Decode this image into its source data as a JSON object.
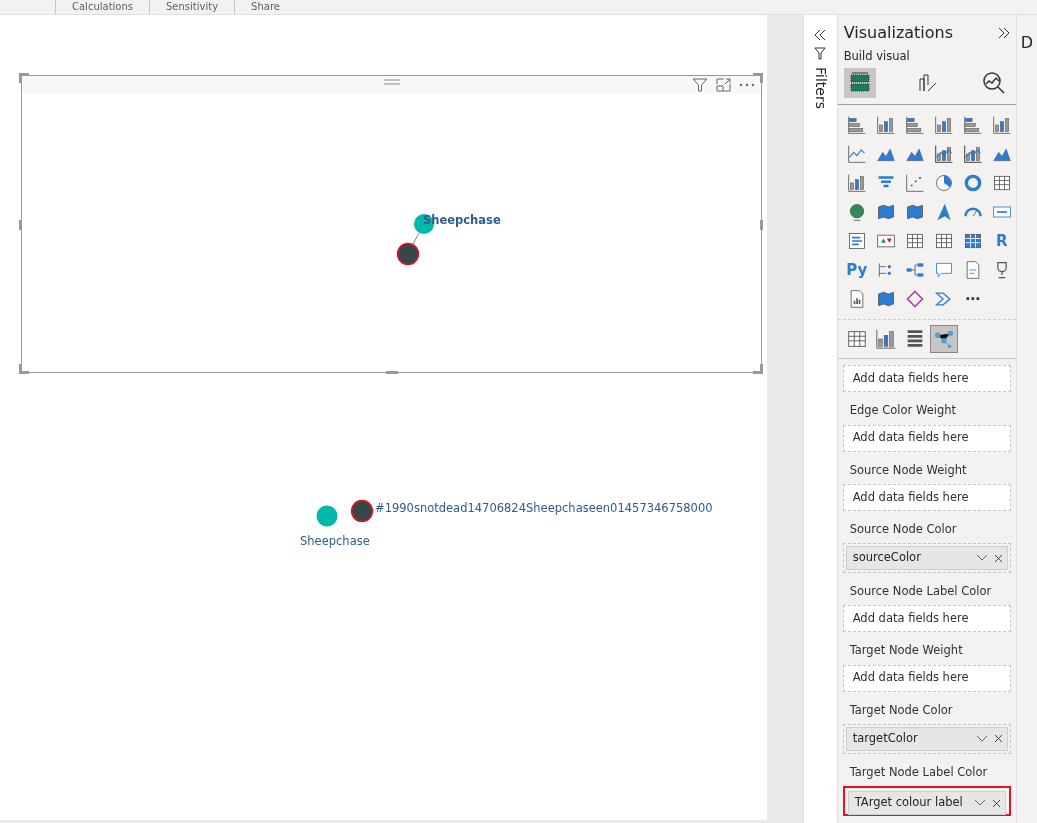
{
  "ribbon": {
    "tabs": [
      "Calculations",
      "Sensitivity",
      "Share"
    ]
  },
  "visual": {
    "nodes": [
      {
        "label": "Sheepchase",
        "color": "#01b8aa"
      },
      {
        "color": "#374649"
      }
    ]
  },
  "loose_graph": {
    "labels": [
      "Sheepchase",
      "#1990snotdead14706824Sheepchaseen01457346758000"
    ],
    "nodes": [
      {
        "color": "#01b8aa"
      },
      {
        "color": "#374649"
      }
    ]
  },
  "filters_pane": {
    "title": "Filters"
  },
  "visualizations": {
    "title": "Visualizations",
    "subtitle": "Build visual",
    "build_tabs": [
      {
        "selected": true
      },
      {
        "selected": false
      },
      {
        "selected": false
      }
    ],
    "gallery_texts": [
      "R",
      "Py",
      "⋯"
    ],
    "custom_visuals": [
      {
        "selected": false
      },
      {
        "selected": false
      },
      {
        "selected": false
      },
      {
        "selected": true
      }
    ],
    "wells": [
      {
        "placeholder": "Add data fields here",
        "highlighted": false
      },
      {
        "label": "Edge Color Weight",
        "placeholder": "Add data fields here",
        "highlighted": false
      },
      {
        "label": "Source Node Weight",
        "placeholder": "Add data fields here",
        "highlighted": false
      },
      {
        "label": "Source Node Color",
        "field": "sourceColor",
        "highlighted": false
      },
      {
        "label": "Source Node Label Color",
        "placeholder": "Add data fields here",
        "highlighted": false
      },
      {
        "label": "Target Node Weight",
        "placeholder": "Add data fields here",
        "highlighted": false
      },
      {
        "label": "Target Node Color",
        "field": "targetColor",
        "highlighted": false
      },
      {
        "label": "Target Node Label Color",
        "field": "TArget colour label",
        "highlighted": true
      }
    ]
  },
  "data_pane": {
    "title": "D"
  }
}
